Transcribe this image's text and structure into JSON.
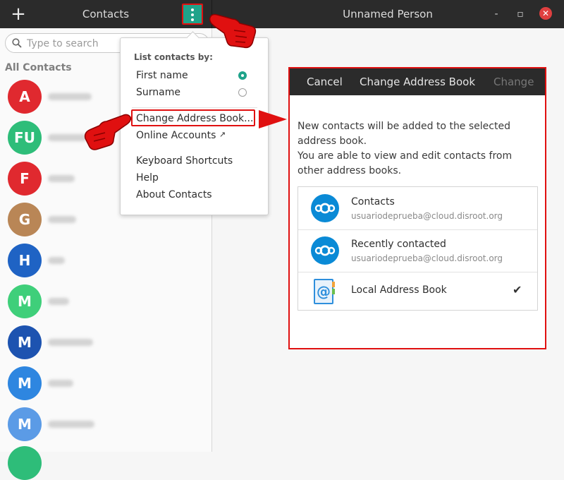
{
  "header": {
    "add_icon": "plus-icon",
    "left_title": "Contacts",
    "menu_icon": "vertical-dots-icon",
    "right_title": "Unnamed Person",
    "minimize_symbol": "-",
    "maximize_symbol": "▫",
    "close_symbol": "✕"
  },
  "sidebar": {
    "search_placeholder": "Type to search",
    "section_title": "All Contacts",
    "contacts": [
      {
        "initials": "A",
        "color": "#e0292f"
      },
      {
        "initials": "FU",
        "color": "#2ebd79"
      },
      {
        "initials": "F",
        "color": "#e0292f"
      },
      {
        "initials": "G",
        "color": "#b98656"
      },
      {
        "initials": "H",
        "color": "#1f63c4"
      },
      {
        "initials": "M",
        "color": "#3fcf7a"
      },
      {
        "initials": "M",
        "color": "#1d53b0"
      },
      {
        "initials": "M",
        "color": "#2e86e0"
      },
      {
        "initials": "M",
        "color": "#5b9be6"
      }
    ]
  },
  "menu": {
    "heading": "List contacts by:",
    "sort_first_name": "First name",
    "sort_surname": "Surname",
    "change_address_book": "Change Address Book...",
    "online_accounts": "Online Accounts",
    "online_accounts_arrow": "↗",
    "keyboard_shortcuts": "Keyboard Shortcuts",
    "help": "Help",
    "about": "About Contacts"
  },
  "dialog": {
    "cancel": "Cancel",
    "title": "Change Address Book",
    "change": "Change",
    "description_line1": "New contacts will be added to the selected address book.",
    "description_line2": "You are able to view and edit contacts from other address books.",
    "address_books": [
      {
        "name": "Contacts",
        "account": "usuariodeprueba@cloud.disroot.org",
        "icon": "nextcloud-icon"
      },
      {
        "name": "Recently contacted",
        "account": "usuariodeprueba@cloud.disroot.org",
        "icon": "nextcloud-icon"
      },
      {
        "name": "Local Address Book",
        "icon": "address-book-icon",
        "check": "✔"
      }
    ]
  },
  "colors": {
    "accent": "#1fa38a",
    "annotation": "#e01010",
    "titlebar": "#2b2b2b"
  }
}
